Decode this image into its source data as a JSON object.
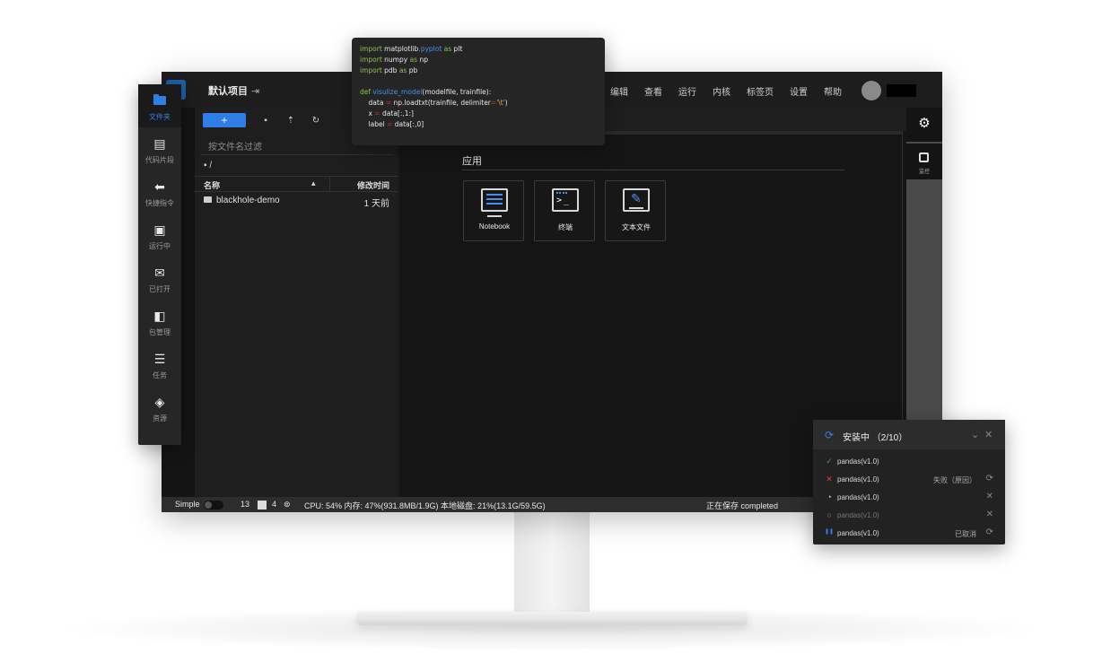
{
  "app": {
    "project_name": "默认项目",
    "project_icon": "exit-icon",
    "menu": [
      "编辑",
      "查看",
      "运行",
      "内核",
      "标签页",
      "设置",
      "帮助"
    ]
  },
  "sidenav": {
    "items": [
      {
        "label": "文件夹",
        "icon": "folder-icon",
        "active": true
      },
      {
        "label": "代码片段",
        "icon": "snippet-icon"
      },
      {
        "label": "快捷指令",
        "icon": "reply-icon"
      },
      {
        "label": "运行中",
        "icon": "briefcase-icon"
      },
      {
        "label": "已打开",
        "icon": "envelope-open-icon"
      },
      {
        "label": "包管理",
        "icon": "package-icon"
      },
      {
        "label": "任务",
        "icon": "task-icon"
      },
      {
        "label": "资源",
        "icon": "layers-icon"
      }
    ]
  },
  "filebrowser": {
    "new_label": "+",
    "filter_placeholder": "按文件名过滤",
    "breadcrumb": "/",
    "col_name": "名称",
    "col_modified": "修改时间",
    "files": [
      {
        "name": "blackhole-demo",
        "modified": "1 天前"
      }
    ]
  },
  "launcher": {
    "section_title": "应用",
    "apps": [
      {
        "label": "Notebook",
        "icon": "notebook-icon"
      },
      {
        "label": "终端",
        "icon": "terminal-icon"
      },
      {
        "label": "文本文件",
        "icon": "text-file-icon"
      }
    ]
  },
  "rightbar": {
    "monitor_label": "监控"
  },
  "statusbar": {
    "mode_label": "Simple",
    "count_a": "13",
    "count_b": "4",
    "resources": "CPU: 54% 内存: 47%(931.8MB/1.9G) 本地磁盘: 21%(13.1G/59.5G)",
    "save_status": "正在保存 completed"
  },
  "code_snippet": {
    "lines": [
      [
        {
          "t": "import ",
          "c": "kw"
        },
        {
          "t": "matplotlib",
          "c": ""
        },
        {
          "t": ".pyplot ",
          "c": "fn"
        },
        {
          "t": "as ",
          "c": "kw"
        },
        {
          "t": "plt",
          "c": ""
        }
      ],
      [
        {
          "t": "import ",
          "c": "kw"
        },
        {
          "t": "numpy ",
          "c": ""
        },
        {
          "t": "as ",
          "c": "kw"
        },
        {
          "t": "np",
          "c": ""
        }
      ],
      [
        {
          "t": "import ",
          "c": "kw"
        },
        {
          "t": "pdb ",
          "c": ""
        },
        {
          "t": "as ",
          "c": "kw"
        },
        {
          "t": "pb",
          "c": ""
        }
      ],
      [],
      [
        {
          "t": "def ",
          "c": "kw"
        },
        {
          "t": "visulize_model",
          "c": "fn"
        },
        {
          "t": "(modelfile, trainfile):",
          "c": ""
        }
      ],
      [
        {
          "t": "    data ",
          "c": ""
        },
        {
          "t": "= ",
          "c": "op"
        },
        {
          "t": "np.loadtxt(trainfile, delimiter",
          "c": ""
        },
        {
          "t": "=",
          "c": "op"
        },
        {
          "t": "'\\t'",
          "c": "st"
        },
        {
          "t": ")",
          "c": ""
        }
      ],
      [
        {
          "t": "    x ",
          "c": ""
        },
        {
          "t": "= ",
          "c": "op"
        },
        {
          "t": "data[:,1:]",
          "c": ""
        }
      ],
      [
        {
          "t": "    label ",
          "c": ""
        },
        {
          "t": "= ",
          "c": "op"
        },
        {
          "t": "data[:,0]",
          "c": ""
        }
      ]
    ]
  },
  "install": {
    "title": "安装中 （2/10）",
    "items": [
      {
        "pkg": "pandas(v1.0)",
        "status": "success",
        "message": "",
        "action": ""
      },
      {
        "pkg": "pandas(v1.0)",
        "status": "failed",
        "message": "失败（原因）",
        "action": "retry"
      },
      {
        "pkg": "pandas(v1.0)",
        "status": "installing",
        "message": "",
        "action": "cancel"
      },
      {
        "pkg": "pandas(v1.0)",
        "status": "waiting",
        "message": "",
        "action": "cancel"
      },
      {
        "pkg": "pandas(v1.0)",
        "status": "paused",
        "message": "已取消",
        "action": "retry"
      }
    ]
  },
  "colors": {
    "accent": "#2f7ee6",
    "success": "#43a047",
    "error": "#e53935"
  }
}
